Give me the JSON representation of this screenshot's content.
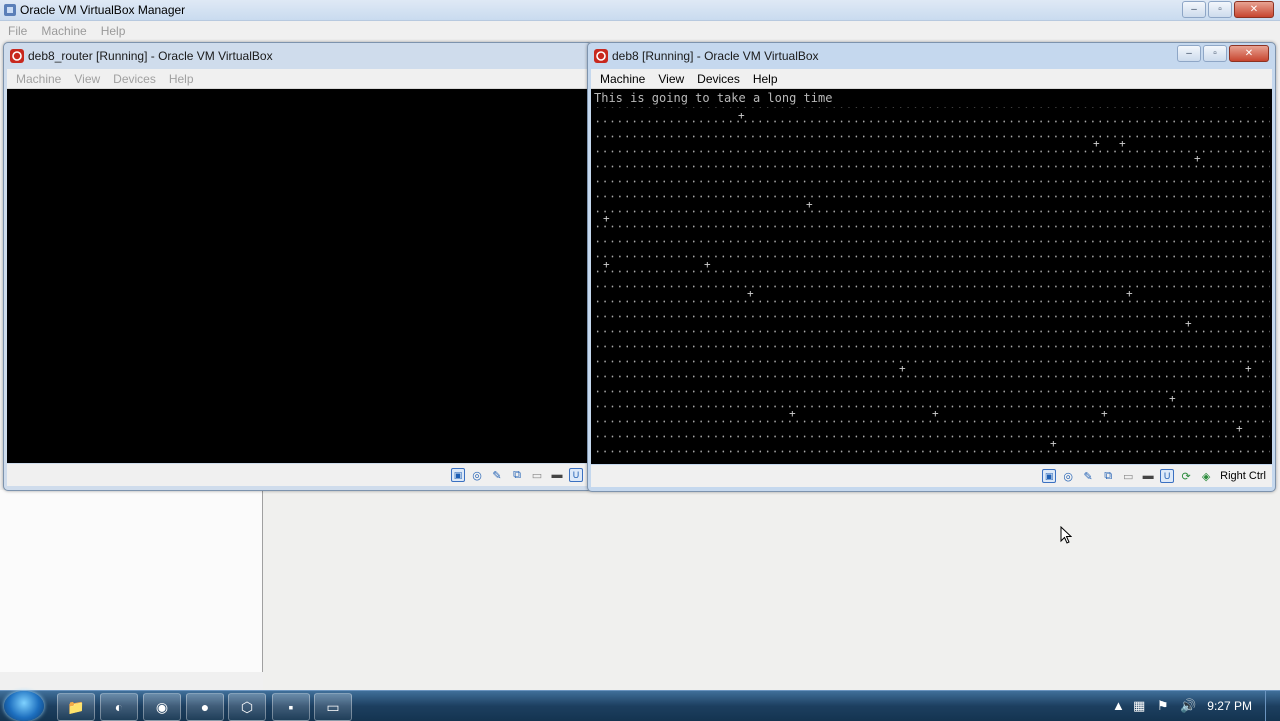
{
  "manager": {
    "title": "Oracle VM VirtualBox Manager",
    "menu": [
      "File",
      "Machine",
      "Help"
    ]
  },
  "router_window": {
    "title": "deb8_router [Running] - Oracle VM VirtualBox",
    "menu": [
      "Machine",
      "View",
      "Devices",
      "Help"
    ]
  },
  "deb8_window": {
    "title": "deb8 [Running] - Oracle VM VirtualBox",
    "menu": [
      "Machine",
      "View",
      "Devices",
      "Help"
    ],
    "terminal_line": "This is going to take a long time",
    "host_key": "Right Ctrl"
  },
  "status_icons": [
    "hdd-icon",
    "optical-icon",
    "usb-icon",
    "network-icon",
    "shared-folder-icon",
    "display-icon",
    "video-capture-icon"
  ],
  "taskbar": {
    "clock": "9:27 PM",
    "apps": [
      "explorer-icon",
      "media-icon",
      "chrome-icon",
      "firefox-icon",
      "virtualbox-icon",
      "save-icon",
      "window-icon"
    ]
  },
  "colors": {
    "titlebar": "#cfdcec",
    "terminal_bg": "#000000",
    "terminal_fg": "#b9b9b9",
    "taskbar": "#1d3f60"
  }
}
